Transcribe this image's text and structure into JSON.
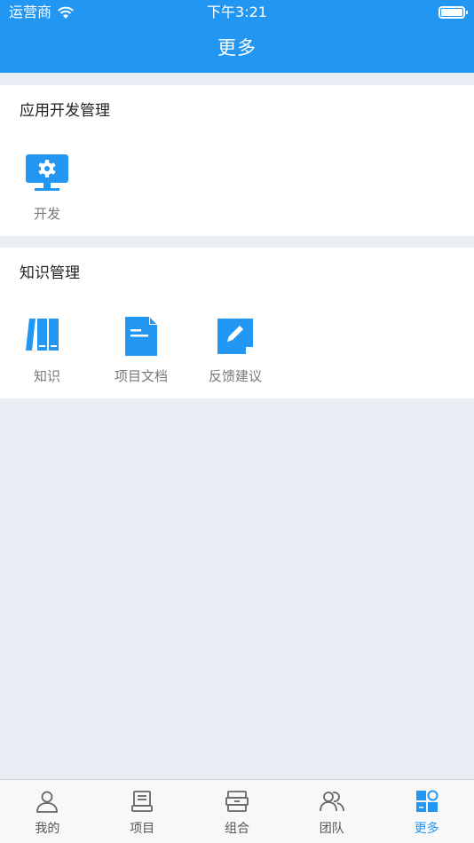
{
  "status_bar": {
    "carrier": "运营商",
    "time": "下午3:21"
  },
  "nav": {
    "title": "更多"
  },
  "sections": [
    {
      "title": "应用开发管理",
      "items": [
        {
          "label": "开发",
          "icon": "monitor-gear-icon"
        }
      ]
    },
    {
      "title": "知识管理",
      "items": [
        {
          "label": "知识",
          "icon": "books-icon"
        },
        {
          "label": "项目文档",
          "icon": "document-icon"
        },
        {
          "label": "反馈建议",
          "icon": "edit-note-icon"
        }
      ]
    }
  ],
  "tabbar": {
    "items": [
      {
        "label": "我的",
        "icon": "person-icon"
      },
      {
        "label": "项目",
        "icon": "project-icon"
      },
      {
        "label": "组合",
        "icon": "stack-icon"
      },
      {
        "label": "团队",
        "icon": "team-icon"
      },
      {
        "label": "更多",
        "icon": "more-grid-icon",
        "active": true
      }
    ]
  },
  "colors": {
    "primary": "#2196F3",
    "background": "#E8EEF4",
    "tab_inactive": "#555555"
  }
}
